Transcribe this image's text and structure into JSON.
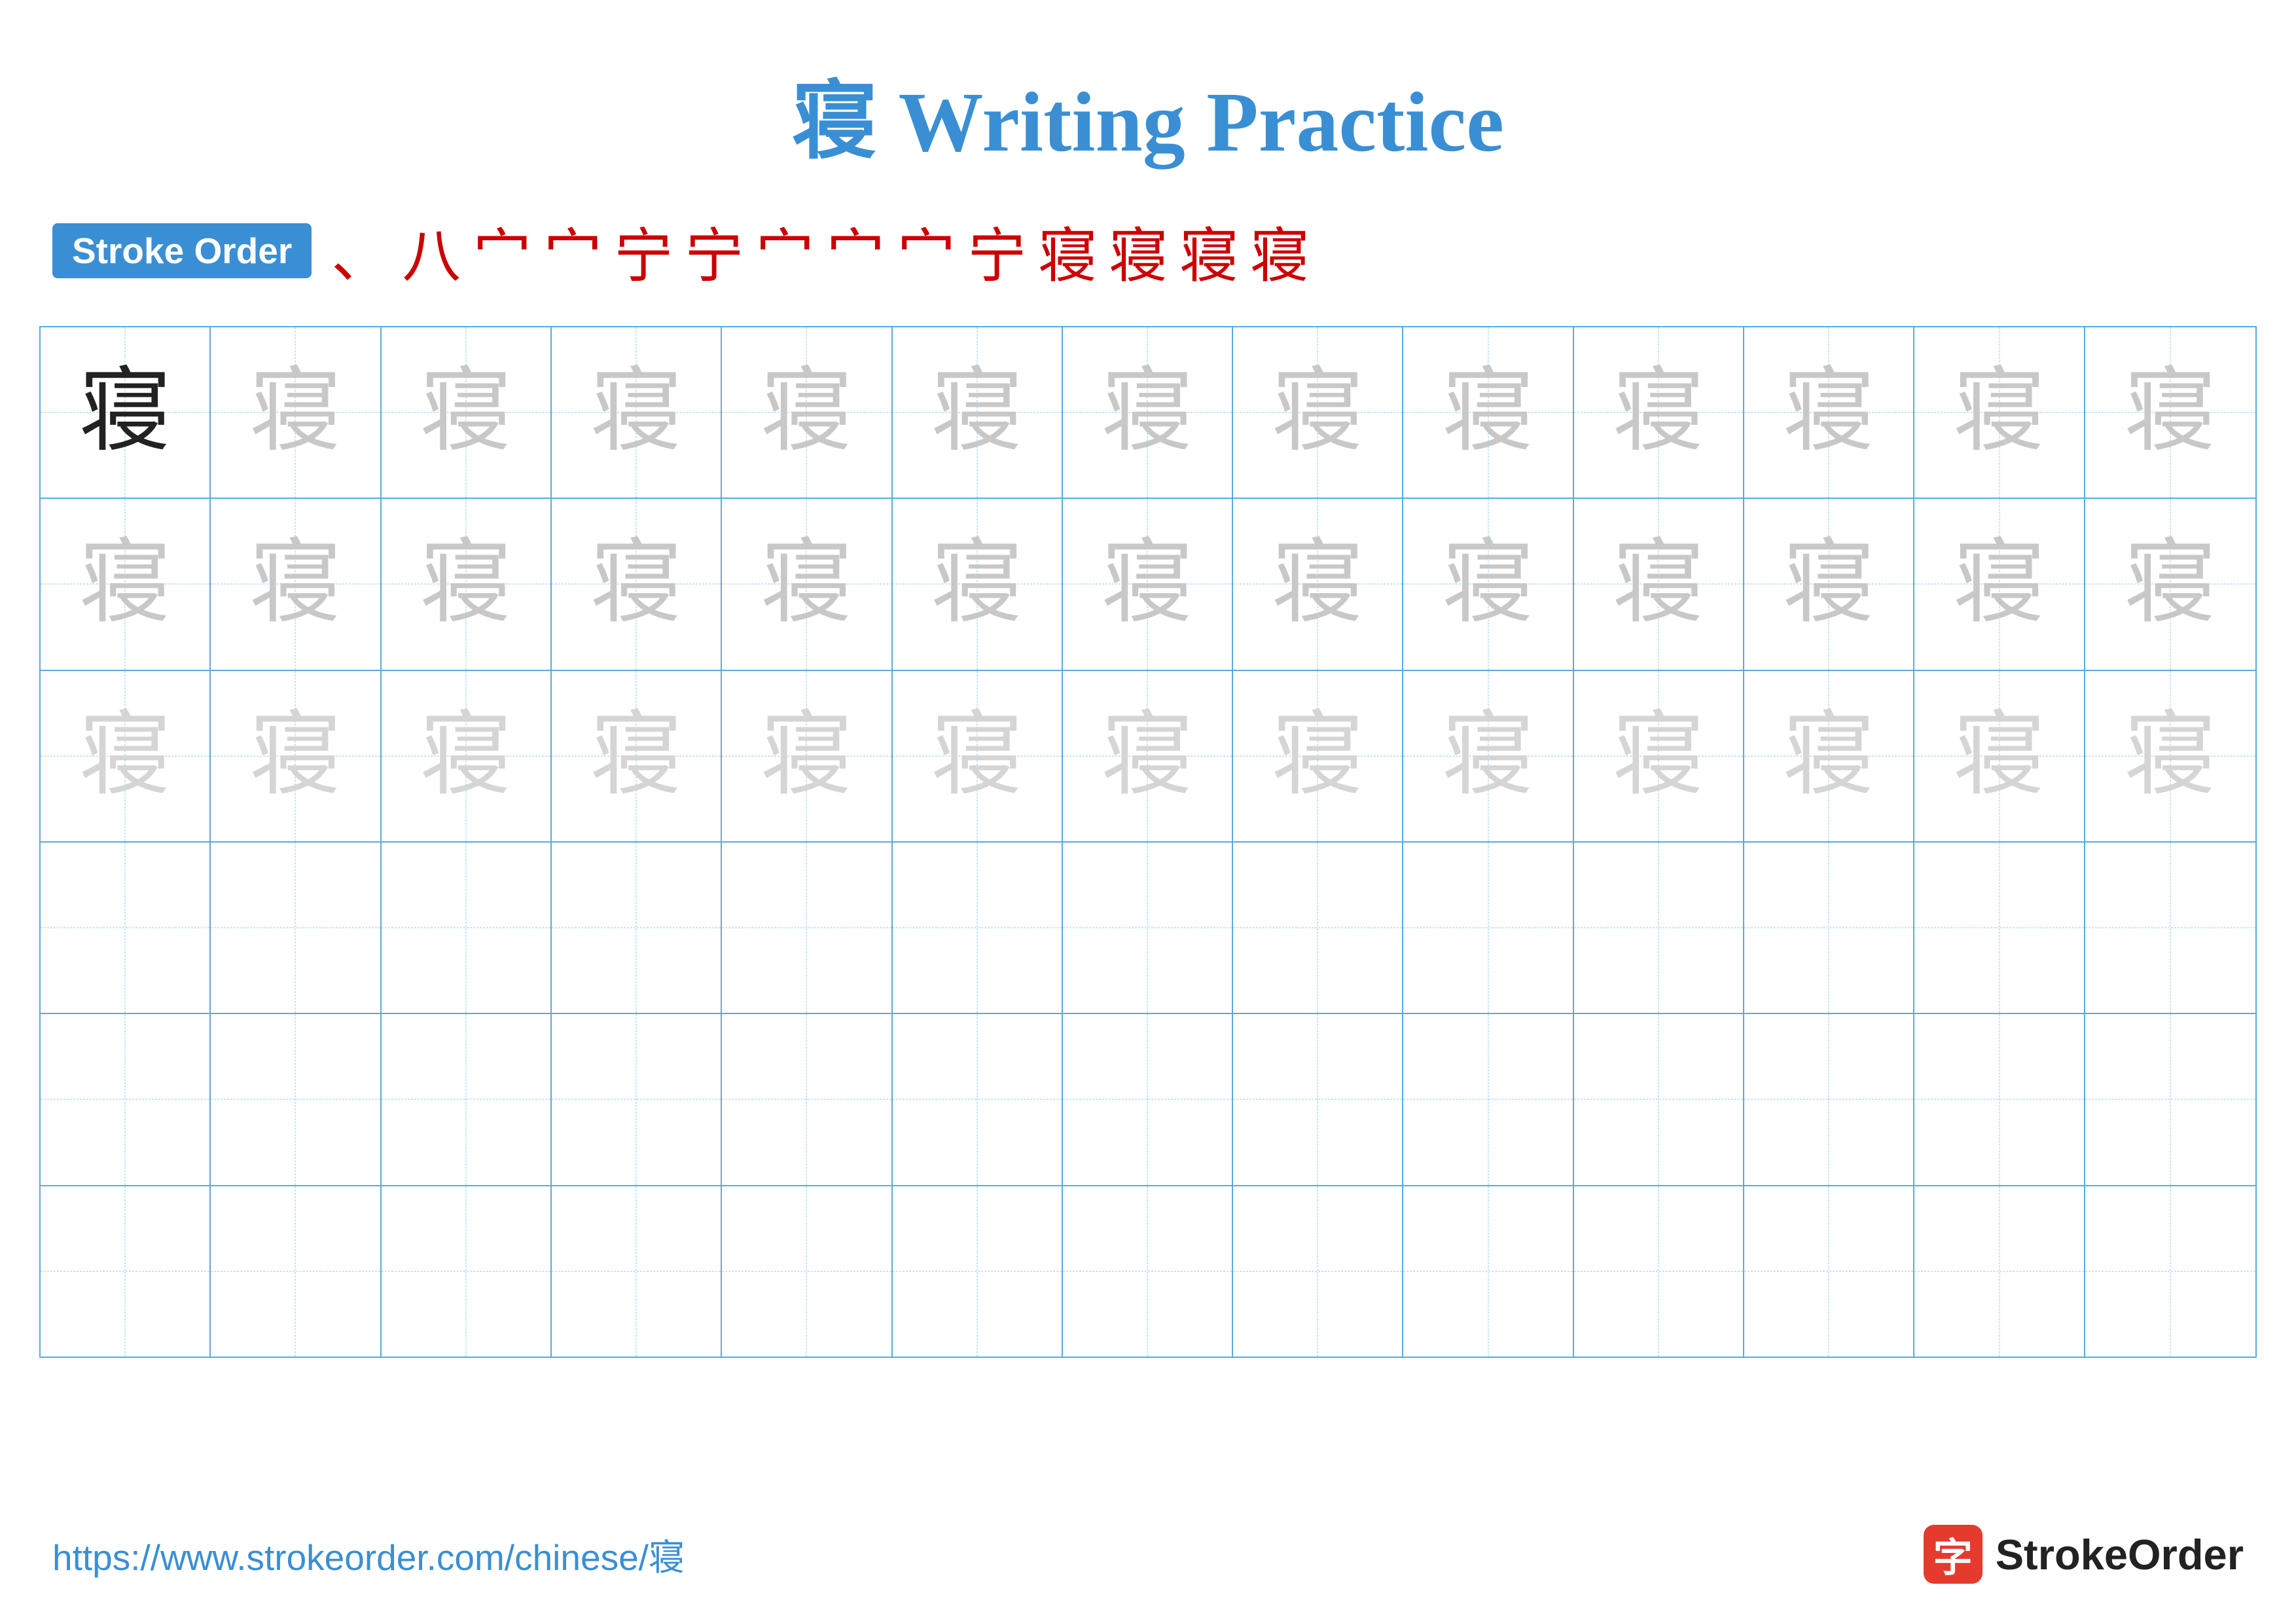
{
  "title": {
    "char": "寝",
    "text": " Writing Practice"
  },
  "stroke_order": {
    "badge_label": "Stroke Order",
    "strokes": [
      "、",
      "八",
      "宀",
      "宀",
      "宁",
      "宁",
      "宀",
      "宀",
      "宀",
      "宁",
      "寝",
      "寝",
      "寝",
      "寝"
    ]
  },
  "grid": {
    "rows": [
      {
        "cells": [
          {
            "char": "寝",
            "style": "dark"
          },
          {
            "char": "寝",
            "style": "light1"
          },
          {
            "char": "寝",
            "style": "light1"
          },
          {
            "char": "寝",
            "style": "light1"
          },
          {
            "char": "寝",
            "style": "light1"
          },
          {
            "char": "寝",
            "style": "light1"
          },
          {
            "char": "寝",
            "style": "light1"
          },
          {
            "char": "寝",
            "style": "light1"
          },
          {
            "char": "寝",
            "style": "light1"
          },
          {
            "char": "寝",
            "style": "light1"
          },
          {
            "char": "寝",
            "style": "light1"
          },
          {
            "char": "寝",
            "style": "light1"
          },
          {
            "char": "寝",
            "style": "light1"
          }
        ]
      },
      {
        "cells": [
          {
            "char": "寝",
            "style": "light1"
          },
          {
            "char": "寝",
            "style": "light1"
          },
          {
            "char": "寝",
            "style": "light1"
          },
          {
            "char": "寝",
            "style": "light1"
          },
          {
            "char": "寝",
            "style": "light1"
          },
          {
            "char": "寝",
            "style": "light1"
          },
          {
            "char": "寝",
            "style": "light1"
          },
          {
            "char": "寝",
            "style": "light1"
          },
          {
            "char": "寝",
            "style": "light1"
          },
          {
            "char": "寝",
            "style": "light1"
          },
          {
            "char": "寝",
            "style": "light1"
          },
          {
            "char": "寝",
            "style": "light1"
          },
          {
            "char": "寝",
            "style": "light1"
          }
        ]
      },
      {
        "cells": [
          {
            "char": "寝",
            "style": "light2"
          },
          {
            "char": "寝",
            "style": "light2"
          },
          {
            "char": "寝",
            "style": "light2"
          },
          {
            "char": "寝",
            "style": "light2"
          },
          {
            "char": "寝",
            "style": "light2"
          },
          {
            "char": "寝",
            "style": "light2"
          },
          {
            "char": "寝",
            "style": "light2"
          },
          {
            "char": "寝",
            "style": "light2"
          },
          {
            "char": "寝",
            "style": "light2"
          },
          {
            "char": "寝",
            "style": "light2"
          },
          {
            "char": "寝",
            "style": "light2"
          },
          {
            "char": "寝",
            "style": "light2"
          },
          {
            "char": "寝",
            "style": "light2"
          }
        ]
      },
      {
        "cells": [
          {
            "char": "",
            "style": "empty"
          },
          {
            "char": "",
            "style": "empty"
          },
          {
            "char": "",
            "style": "empty"
          },
          {
            "char": "",
            "style": "empty"
          },
          {
            "char": "",
            "style": "empty"
          },
          {
            "char": "",
            "style": "empty"
          },
          {
            "char": "",
            "style": "empty"
          },
          {
            "char": "",
            "style": "empty"
          },
          {
            "char": "",
            "style": "empty"
          },
          {
            "char": "",
            "style": "empty"
          },
          {
            "char": "",
            "style": "empty"
          },
          {
            "char": "",
            "style": "empty"
          },
          {
            "char": "",
            "style": "empty"
          }
        ]
      },
      {
        "cells": [
          {
            "char": "",
            "style": "empty"
          },
          {
            "char": "",
            "style": "empty"
          },
          {
            "char": "",
            "style": "empty"
          },
          {
            "char": "",
            "style": "empty"
          },
          {
            "char": "",
            "style": "empty"
          },
          {
            "char": "",
            "style": "empty"
          },
          {
            "char": "",
            "style": "empty"
          },
          {
            "char": "",
            "style": "empty"
          },
          {
            "char": "",
            "style": "empty"
          },
          {
            "char": "",
            "style": "empty"
          },
          {
            "char": "",
            "style": "empty"
          },
          {
            "char": "",
            "style": "empty"
          },
          {
            "char": "",
            "style": "empty"
          }
        ]
      },
      {
        "cells": [
          {
            "char": "",
            "style": "empty"
          },
          {
            "char": "",
            "style": "empty"
          },
          {
            "char": "",
            "style": "empty"
          },
          {
            "char": "",
            "style": "empty"
          },
          {
            "char": "",
            "style": "empty"
          },
          {
            "char": "",
            "style": "empty"
          },
          {
            "char": "",
            "style": "empty"
          },
          {
            "char": "",
            "style": "empty"
          },
          {
            "char": "",
            "style": "empty"
          },
          {
            "char": "",
            "style": "empty"
          },
          {
            "char": "",
            "style": "empty"
          },
          {
            "char": "",
            "style": "empty"
          },
          {
            "char": "",
            "style": "empty"
          }
        ]
      }
    ]
  },
  "footer": {
    "url": "https://www.strokeorder.com/chinese/寝",
    "logo_char": "字",
    "logo_text": "StrokeOrder"
  }
}
